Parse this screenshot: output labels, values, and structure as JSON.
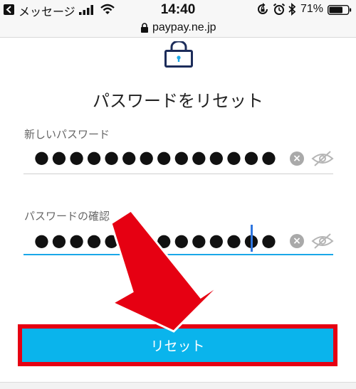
{
  "status_bar": {
    "back_app_label": "メッセージ",
    "time": "14:40",
    "battery_percent": "71%"
  },
  "browser": {
    "url": "paypay.ne.jp"
  },
  "page": {
    "title": "パスワードをリセット",
    "new_password": {
      "label": "新しいパスワード",
      "masked_value": "●●●●●●●●●●●●●●"
    },
    "confirm_password": {
      "label": "パスワードの確認",
      "masked_value": "●●●●●●●●●●●●●●"
    },
    "clear_glyph": "×",
    "reset_button_label": "リセット"
  },
  "colors": {
    "accent": "#0ab4ec",
    "annotation_red": "#e60012",
    "active_underline": "#1aa7e8"
  },
  "icons": [
    "chevron-left-icon",
    "signal-icon",
    "wifi-icon",
    "rotation-lock-icon",
    "alarm-icon",
    "bluetooth-icon",
    "battery-icon",
    "lock-icon",
    "clear-icon",
    "eye-slash-icon"
  ]
}
